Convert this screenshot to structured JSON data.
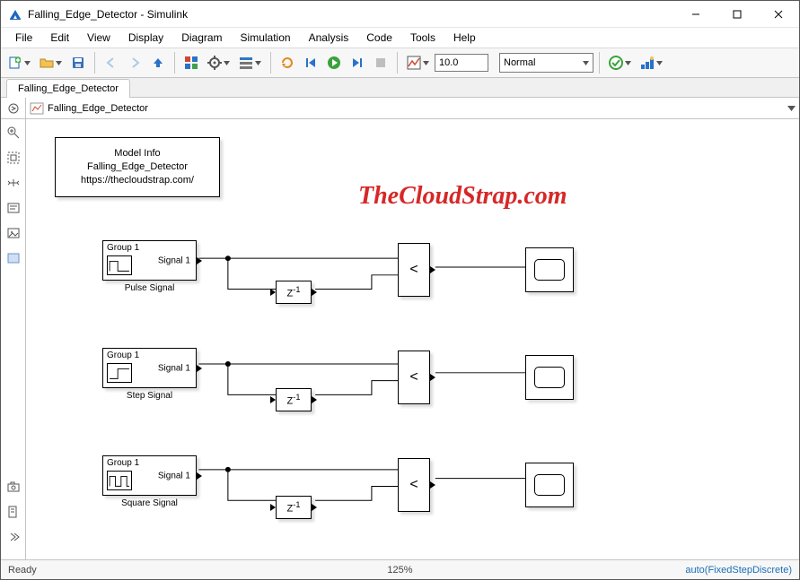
{
  "titlebar": {
    "title": "Falling_Edge_Detector - Simulink"
  },
  "menu": {
    "file": "File",
    "edit": "Edit",
    "view": "View",
    "display": "Display",
    "diagram": "Diagram",
    "simulation": "Simulation",
    "analysis": "Analysis",
    "code": "Code",
    "tools": "Tools",
    "help": "Help"
  },
  "toolbar": {
    "stoptime": "10.0",
    "mode": "Normal"
  },
  "tab": {
    "name": "Falling_Edge_Detector"
  },
  "breadcrumb": {
    "model": "Falling_Edge_Detector"
  },
  "canvas": {
    "info": {
      "line1": "Model Info",
      "line2": "Falling_Edge_Detector",
      "line3": "https://thecloudstrap.com/"
    },
    "watermark": "TheCloudStrap.com",
    "group_label": "Group 1",
    "signal_port": "Signal 1",
    "delay_label": "Z",
    "delay_sup": "-1",
    "compare_label": "<",
    "rows": [
      {
        "name": "Pulse Signal"
      },
      {
        "name": "Step Signal"
      },
      {
        "name": "Square Signal"
      }
    ]
  },
  "status": {
    "ready": "Ready",
    "zoom": "125%",
    "solver": "auto(FixedStepDiscrete)"
  }
}
